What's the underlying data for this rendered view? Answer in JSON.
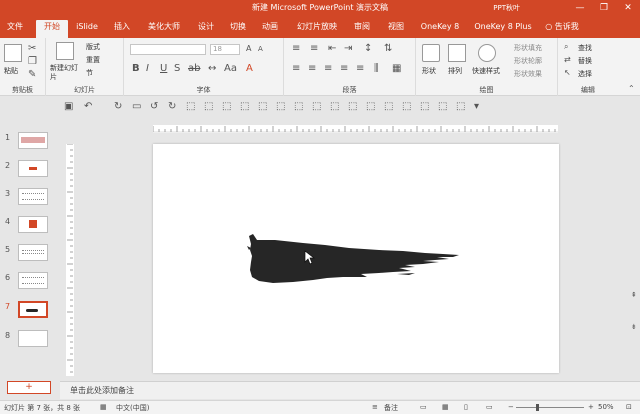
{
  "window": {
    "title": "新建 Microsoft PowerPoint 演示文稿",
    "user": "PPT秋叶",
    "minimize": "—",
    "restore": "❐",
    "close": "✕"
  },
  "tabs": [
    {
      "label": "文件"
    },
    {
      "label": "开始"
    },
    {
      "label": "iSlide"
    },
    {
      "label": "插入"
    },
    {
      "label": "美化大师"
    },
    {
      "label": "设计"
    },
    {
      "label": "切换"
    },
    {
      "label": "动画"
    },
    {
      "label": "幻灯片放映"
    },
    {
      "label": "审阅"
    },
    {
      "label": "视图"
    },
    {
      "label": "OneKey 8"
    },
    {
      "label": "OneKey 8 Plus"
    },
    {
      "label": "告诉我"
    }
  ],
  "ribbon": {
    "clipboard": {
      "paste": "粘贴",
      "label": "剪贴板"
    },
    "slides": {
      "new_slide": "新建幻灯片",
      "layout": "版式",
      "reset": "重置",
      "section": "节",
      "label": "幻灯片"
    },
    "font": {
      "font_size": "18",
      "label": "字体"
    },
    "paragraph": {
      "label": "段落"
    },
    "drawing": {
      "shape": "形状",
      "arrange": "排列",
      "quick_styles": "快速样式",
      "fill": "形状填充",
      "outline": "形状轮廓",
      "effects": "形状效果",
      "label": "绘图"
    },
    "editing": {
      "find": "查找",
      "replace": "替换",
      "select": "选择",
      "label": "编辑"
    }
  },
  "thumbnails": [
    {
      "num": "1"
    },
    {
      "num": "2"
    },
    {
      "num": "3"
    },
    {
      "num": "4"
    },
    {
      "num": "5"
    },
    {
      "num": "6"
    },
    {
      "num": "7"
    },
    {
      "num": "8"
    }
  ],
  "add_slide": "+",
  "notes_placeholder": "单击此处添加备注",
  "status": {
    "slide_info": "幻灯片 第 7 张，共 8 张",
    "language": "中文(中国)",
    "notes_btn": "备注",
    "zoom": "50%",
    "zoom_out": "−",
    "zoom_in": "+"
  },
  "colors": {
    "accent": "#d24726",
    "brush": "#262626"
  }
}
